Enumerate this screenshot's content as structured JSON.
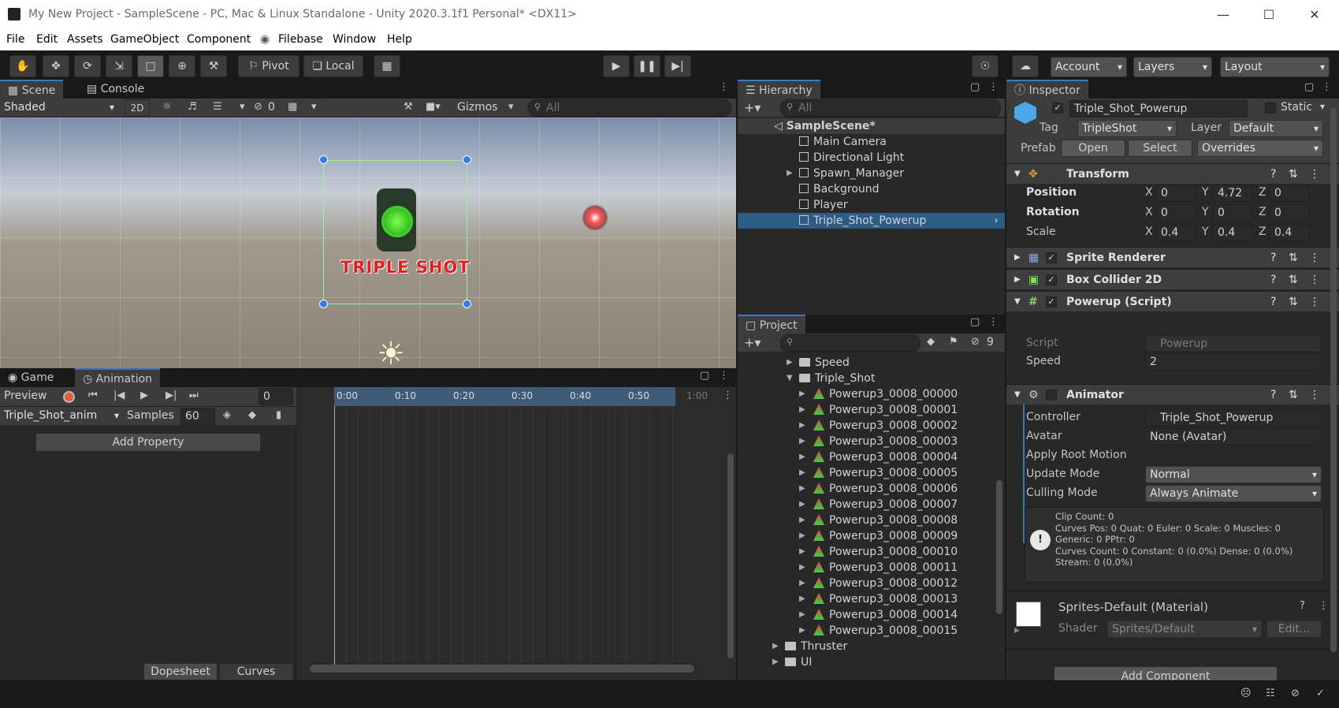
{
  "window": {
    "title": "My New Project - SampleScene - PC, Mac & Linux Standalone - Unity 2020.3.1f1 Personal* <DX11>"
  },
  "menu": [
    "File",
    "Edit",
    "Assets",
    "GameObject",
    "Component",
    "Filebase",
    "Window",
    "Help"
  ],
  "toolbar": {
    "pivot": "Pivot",
    "local": "Local",
    "account": "Account",
    "layers": "Layers",
    "layout": "Layout"
  },
  "scene": {
    "tab_scene": "Scene",
    "tab_console": "Console",
    "shading": "Shaded",
    "mode2d": "2D",
    "hidden_count": "0",
    "gizmos": "Gizmos",
    "search_placeholder": "All",
    "powerup_label": "TRIPLE SHOT"
  },
  "animation": {
    "tab_game": "Game",
    "tab_animation": "Animation",
    "preview": "Preview",
    "frame": "0",
    "clip": "Triple_Shot_anim",
    "samples_label": "Samples",
    "samples": "60",
    "add_property": "Add Property",
    "dopesheet": "Dopesheet",
    "curves": "Curves",
    "ruler": [
      "0:00",
      "0:10",
      "0:20",
      "0:30",
      "0:40",
      "0:50",
      "1:00"
    ]
  },
  "hierarchy": {
    "tab": "Hierarchy",
    "search_placeholder": "All",
    "scene": "SampleScene*",
    "items": [
      "Main Camera",
      "Directional Light",
      "Spawn_Manager",
      "Background",
      "Player",
      "Triple_Shot_Powerup"
    ],
    "selected": "Triple_Shot_Powerup"
  },
  "project": {
    "tab": "Project",
    "hidden_count": "9",
    "folders": [
      "Speed",
      "Triple_Shot"
    ],
    "assets": [
      "Powerup3_0008_00000",
      "Powerup3_0008_00001",
      "Powerup3_0008_00002",
      "Powerup3_0008_00003",
      "Powerup3_0008_00004",
      "Powerup3_0008_00005",
      "Powerup3_0008_00006",
      "Powerup3_0008_00007",
      "Powerup3_0008_00008",
      "Powerup3_0008_00009",
      "Powerup3_0008_00010",
      "Powerup3_0008_00011",
      "Powerup3_0008_00012",
      "Powerup3_0008_00013",
      "Powerup3_0008_00014",
      "Powerup3_0008_00015"
    ],
    "after": [
      "Thruster",
      "UI"
    ]
  },
  "inspector": {
    "tab": "Inspector",
    "name": "Triple_Shot_Powerup",
    "static": "Static",
    "tag_label": "Tag",
    "tag": "TripleShot",
    "layer_label": "Layer",
    "layer": "Default",
    "prefab_label": "Prefab",
    "open": "Open",
    "select": "Select",
    "overrides": "Overrides",
    "transform": {
      "title": "Transform",
      "position": "Position",
      "rotation": "Rotation",
      "scale": "Scale",
      "pos": [
        "0",
        "4.72",
        "0"
      ],
      "rot": [
        "0",
        "0",
        "0"
      ],
      "scl": [
        "0.4",
        "0.4",
        "0.4"
      ]
    },
    "sprite_renderer": "Sprite Renderer",
    "box_collider": "Box Collider 2D",
    "powerup": {
      "title": "Powerup (Script)",
      "script_label": "Script",
      "script": "Powerup",
      "speed_label": "Speed",
      "speed": "2"
    },
    "animator": {
      "title": "Animator",
      "controller_label": "Controller",
      "controller": "Triple_Shot_Powerup",
      "avatar_label": "Avatar",
      "avatar": "None (Avatar)",
      "root_motion": "Apply Root Motion",
      "update_label": "Update Mode",
      "update": "Normal",
      "culling_label": "Culling Mode",
      "culling": "Always Animate",
      "info": [
        "Clip Count: 0",
        "Curves Pos: 0 Quat: 0 Euler: 0 Scale: 0 Muscles: 0",
        "Generic: 0 PPtr: 0",
        "Curves Count: 0 Constant: 0 (0.0%) Dense: 0 (0.0%)",
        "Stream: 0 (0.0%)"
      ]
    },
    "material": {
      "title": "Sprites-Default (Material)",
      "shader_label": "Shader",
      "shader": "Sprites/Default",
      "edit": "Edit..."
    },
    "add_component": "Add Component"
  },
  "colors": {
    "selection": "#2c5d87",
    "accent": "#3a79bb",
    "panel": "#282828"
  }
}
